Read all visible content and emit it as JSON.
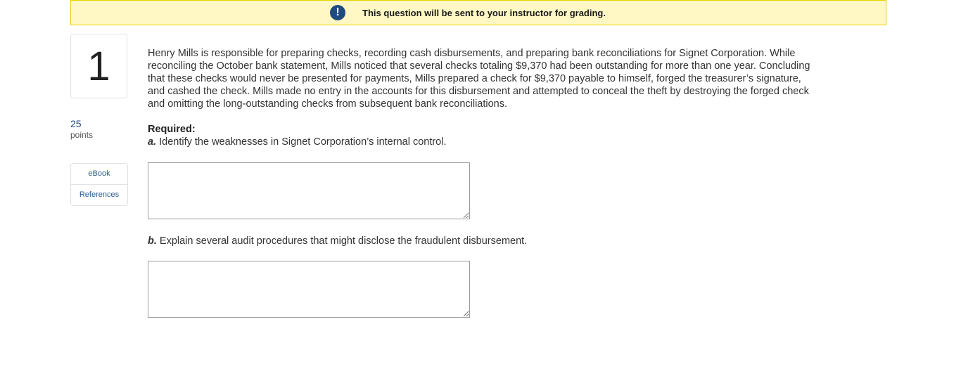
{
  "banner": {
    "icon": "exclamation-icon",
    "text": "This question will be sent to your instructor for grading.",
    "accent_color": "#1e4a80",
    "background_color": "#fff8c4"
  },
  "question": {
    "number": "1",
    "points_value": "25",
    "points_label": "points"
  },
  "resources": [
    {
      "label": "eBook"
    },
    {
      "label": "References"
    }
  ],
  "body": {
    "paragraph": "Henry Mills is responsible for preparing checks, recording cash disbursements, and preparing bank reconciliations for Signet Corporation. While reconciling the October bank statement, Mills noticed that several checks totaling $9,370 had been outstanding for more than one year. Concluding that these checks would never be presented for payments, Mills prepared a check for $9,370 payable to himself, forged the treasurer’s signature, and cashed the check. Mills made no entry in the accounts for this disbursement and attempted to conceal the theft by destroying the forged check and omitting the long-outstanding checks from subsequent bank reconciliations.",
    "required_heading": "Required:",
    "parts": [
      {
        "letter": "a.",
        "text": " Identify the weaknesses in Signet Corporation’s internal control.",
        "answer_value": ""
      },
      {
        "letter": "b.",
        "text": " Explain several audit procedures that might disclose the fraudulent disbursement.",
        "answer_value": ""
      }
    ]
  }
}
